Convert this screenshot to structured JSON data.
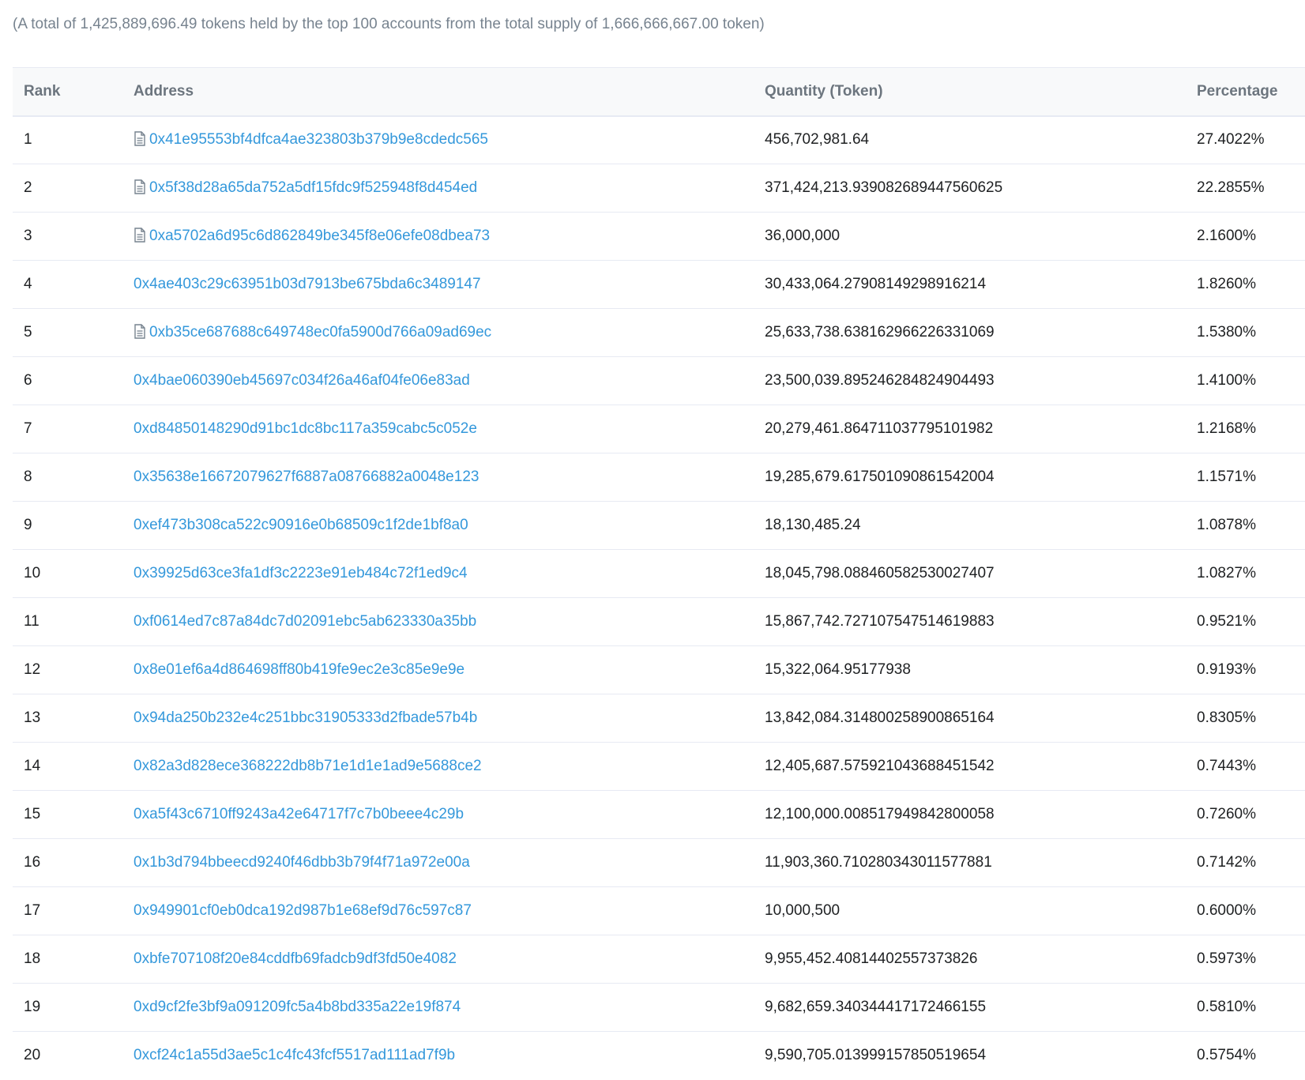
{
  "summary": "(A total of 1,425,889,696.49 tokens held by the top 100 accounts from the total supply of 1,666,666,667.00 token)",
  "table": {
    "headers": {
      "rank": "Rank",
      "address": "Address",
      "quantity": "Quantity (Token)",
      "percentage": "Percentage"
    },
    "rows": [
      {
        "rank": "1",
        "address": "0x41e95553bf4dfca4ae323803b379b9e8cdedc565",
        "is_contract": true,
        "quantity": "456,702,981.64",
        "percentage": "27.4022%"
      },
      {
        "rank": "2",
        "address": "0x5f38d28a65da752a5df15fdc9f525948f8d454ed",
        "is_contract": true,
        "quantity": "371,424,213.939082689447560625",
        "percentage": "22.2855%"
      },
      {
        "rank": "3",
        "address": "0xa5702a6d95c6d862849be345f8e06efe08dbea73",
        "is_contract": true,
        "quantity": "36,000,000",
        "percentage": "2.1600%"
      },
      {
        "rank": "4",
        "address": "0x4ae403c29c63951b03d7913be675bda6c3489147",
        "is_contract": false,
        "quantity": "30,433,064.27908149298916214",
        "percentage": "1.8260%"
      },
      {
        "rank": "5",
        "address": "0xb35ce687688c649748ec0fa5900d766a09ad69ec",
        "is_contract": true,
        "quantity": "25,633,738.638162966226331069",
        "percentage": "1.5380%"
      },
      {
        "rank": "6",
        "address": "0x4bae060390eb45697c034f26a46af04fe06e83ad",
        "is_contract": false,
        "quantity": "23,500,039.895246284824904493",
        "percentage": "1.4100%"
      },
      {
        "rank": "7",
        "address": "0xd84850148290d91bc1dc8bc117a359cabc5c052e",
        "is_contract": false,
        "quantity": "20,279,461.864711037795101982",
        "percentage": "1.2168%"
      },
      {
        "rank": "8",
        "address": "0x35638e16672079627f6887a08766882a0048e123",
        "is_contract": false,
        "quantity": "19,285,679.617501090861542004",
        "percentage": "1.1571%"
      },
      {
        "rank": "9",
        "address": "0xef473b308ca522c90916e0b68509c1f2de1bf8a0",
        "is_contract": false,
        "quantity": "18,130,485.24",
        "percentage": "1.0878%"
      },
      {
        "rank": "10",
        "address": "0x39925d63ce3fa1df3c2223e91eb484c72f1ed9c4",
        "is_contract": false,
        "quantity": "18,045,798.088460582530027407",
        "percentage": "1.0827%"
      },
      {
        "rank": "11",
        "address": "0xf0614ed7c87a84dc7d02091ebc5ab623330a35bb",
        "is_contract": false,
        "quantity": "15,867,742.727107547514619883",
        "percentage": "0.9521%"
      },
      {
        "rank": "12",
        "address": "0x8e01ef6a4d864698ff80b419fe9ec2e3c85e9e9e",
        "is_contract": false,
        "quantity": "15,322,064.95177938",
        "percentage": "0.9193%"
      },
      {
        "rank": "13",
        "address": "0x94da250b232e4c251bbc31905333d2fbade57b4b",
        "is_contract": false,
        "quantity": "13,842,084.314800258900865164",
        "percentage": "0.8305%"
      },
      {
        "rank": "14",
        "address": "0x82a3d828ece368222db8b71e1d1e1ad9e5688ce2",
        "is_contract": false,
        "quantity": "12,405,687.575921043688451542",
        "percentage": "0.7443%"
      },
      {
        "rank": "15",
        "address": "0xa5f43c6710ff9243a42e64717f7c7b0beee4c29b",
        "is_contract": false,
        "quantity": "12,100,000.008517949842800058",
        "percentage": "0.7260%"
      },
      {
        "rank": "16",
        "address": "0x1b3d794bbeecd9240f46dbb3b79f4f71a972e00a",
        "is_contract": false,
        "quantity": "11,903,360.710280343011577881",
        "percentage": "0.7142%"
      },
      {
        "rank": "17",
        "address": "0x949901cf0eb0dca192d987b1e68ef9d76c597c87",
        "is_contract": false,
        "quantity": "10,000,500",
        "percentage": "0.6000%"
      },
      {
        "rank": "18",
        "address": "0xbfe707108f20e84cddfb69fadcb9df3fd50e4082",
        "is_contract": false,
        "quantity": "9,955,452.40814402557373826",
        "percentage": "0.5973%"
      },
      {
        "rank": "19",
        "address": "0xd9cf2fe3bf9a091209fc5a4b8bd335a22e19f874",
        "is_contract": false,
        "quantity": "9,682,659.340344417172466155",
        "percentage": "0.5810%"
      },
      {
        "rank": "20",
        "address": "0xcf24c1a55d3ae5c1c4fc43fcf5517ad111ad7f9b",
        "is_contract": false,
        "quantity": "9,590,705.013999157850519654",
        "percentage": "0.5754%"
      }
    ]
  },
  "colors": {
    "link": "#3498db",
    "muted_text": "#77838f",
    "header_text": "#6c757e",
    "header_bg": "#f8f9fa",
    "border": "#e7eaf3"
  },
  "icons": {
    "contract": "file-document-icon"
  }
}
